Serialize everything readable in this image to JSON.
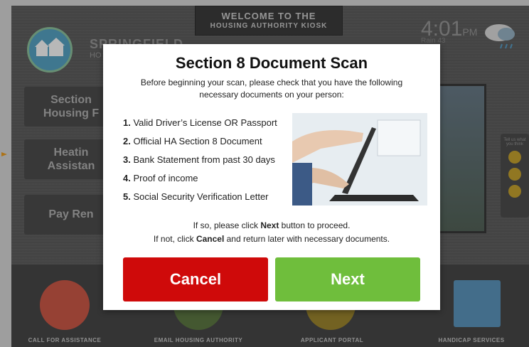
{
  "header": {
    "welcome_line1": "WELCOME TO THE",
    "welcome_line2": "HOUSING AUTHORITY KIOSK",
    "brand_name": "SPRINGFIELD",
    "brand_sub": "HO",
    "time": "4:01",
    "ampm": "PM",
    "weather": "Rain 43"
  },
  "nav": {
    "section8": "Section\nHousing F",
    "heating": "Heatin\nAssistan",
    "payrent": "Pay Ren"
  },
  "feedback": {
    "label": "Tell us what you think"
  },
  "bottom": {
    "call": "CALL FOR ASSISTANCE",
    "email": "EMAIL HOUSING AUTHORITY",
    "portal": "APPLICANT PORTAL",
    "handicap": "HANDICAP SERVICES"
  },
  "modal": {
    "title": "Section 8 Document Scan",
    "intro": "Before beginning your scan, please check that you have the following necessary documents on your person:",
    "documents": [
      {
        "num": "1.",
        "text": "Valid Driver’s License OR Passport"
      },
      {
        "num": "2.",
        "text": "Official HA Section 8 Document"
      },
      {
        "num": "3.",
        "text": "Bank Statement from past 30 days"
      },
      {
        "num": "4.",
        "text": "Proof of income"
      },
      {
        "num": "5.",
        "text": "Social Security Verification Letter"
      }
    ],
    "confirm_line1_pre": "If so, please click ",
    "confirm_line1_bold": "Next",
    "confirm_line1_post": " button to proceed.",
    "confirm_line2_pre": "If not, click ",
    "confirm_line2_bold": "Cancel",
    "confirm_line2_post": " and return later with necessary documents.",
    "cancel_label": "Cancel",
    "next_label": "Next"
  },
  "colors": {
    "cancel": "#cf0a0a",
    "next": "#6fbe3c",
    "logo": "#58a6c6"
  },
  "icons": [
    "house-icon",
    "cloud-rain-icon",
    "phone-icon",
    "envelope-icon",
    "portal-icon",
    "wheelchair-icon",
    "smiley-icon"
  ]
}
